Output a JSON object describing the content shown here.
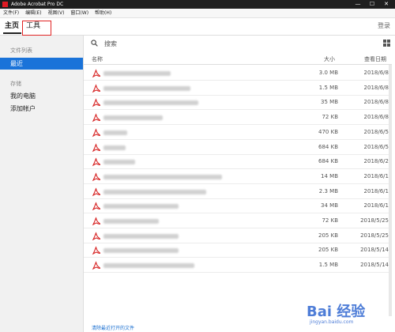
{
  "window": {
    "title": "Adobe Acrobat Pro DC",
    "minimize": "—",
    "maximize": "☐",
    "close": "✕"
  },
  "menu": [
    "文件(F)",
    "编辑(E)",
    "视图(V)",
    "窗口(W)",
    "帮助(H)"
  ],
  "nav": {
    "home_tab": "主页",
    "tools_tab": "工具",
    "signin": "登录"
  },
  "sidebar": {
    "files_section": "文件列表",
    "recent": "最近",
    "storage_section": "存储",
    "my_computer": "我的电脑",
    "add_account": "添加帐户"
  },
  "search": {
    "placeholder": "搜索"
  },
  "columns": {
    "name": "名称",
    "size": "大小",
    "date": "查看日期"
  },
  "files": [
    {
      "size": "3.0 MB",
      "date": "2018/6/8"
    },
    {
      "size": "1.5 MB",
      "date": "2018/6/8"
    },
    {
      "size": "35 MB",
      "date": "2018/6/8"
    },
    {
      "size": "72 KB",
      "date": "2018/6/8"
    },
    {
      "size": "470 KB",
      "date": "2018/6/5"
    },
    {
      "size": "684 KB",
      "date": "2018/6/5"
    },
    {
      "size": "684 KB",
      "date": "2018/6/2"
    },
    {
      "size": "14 MB",
      "date": "2018/6/1"
    },
    {
      "size": "2.3 MB",
      "date": "2018/6/1"
    },
    {
      "size": "34 MB",
      "date": "2018/6/1"
    },
    {
      "size": "72 KB",
      "date": "2018/5/25"
    },
    {
      "size": "205 KB",
      "date": "2018/5/25"
    },
    {
      "size": "205 KB",
      "date": "2018/5/14"
    },
    {
      "size": "1.5 MB",
      "date": "2018/5/14"
    }
  ],
  "footer": {
    "clear_recent": "清除最近打开的文件"
  },
  "watermark": {
    "logo": "Bai 经验",
    "url": "jingyan.baidu.com"
  },
  "colors": {
    "accent": "#1a73d9",
    "highlight": "#e12424",
    "pdf_red": "#d61f1f"
  }
}
